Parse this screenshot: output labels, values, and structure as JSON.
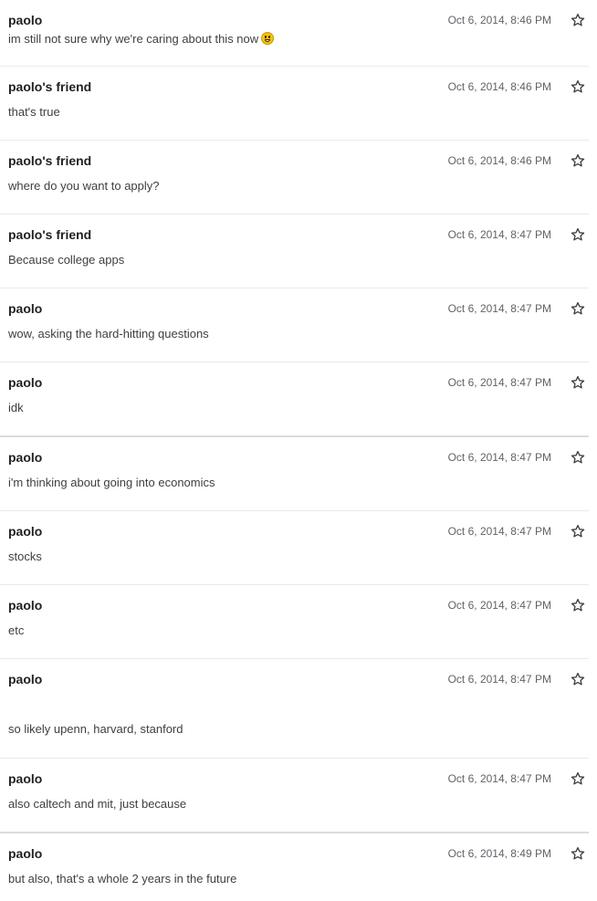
{
  "messages": [
    {
      "sender": "paolo",
      "time": "Oct 6, 2014, 8:46 PM",
      "text": "im still not sure why we're caring about this now",
      "emoji": "grinning-face-emoji"
    },
    {
      "sender": "paolo's friend",
      "time": "Oct 6, 2014, 8:46 PM",
      "text": "that's true"
    },
    {
      "sender": "paolo's friend",
      "time": "Oct 6, 2014, 8:46 PM",
      "text": "where do you want to apply?"
    },
    {
      "sender": "paolo's friend",
      "time": "Oct 6, 2014, 8:47 PM",
      "text": "Because college apps"
    },
    {
      "sender": "paolo",
      "time": "Oct 6, 2014, 8:47 PM",
      "text": "wow, asking the hard-hitting questions"
    },
    {
      "sender": "paolo",
      "time": "Oct 6, 2014, 8:47 PM",
      "text": "idk"
    },
    {
      "sender": "paolo",
      "time": "Oct 6, 2014, 8:47 PM",
      "text": "i'm thinking about going into economics"
    },
    {
      "sender": "paolo",
      "time": "Oct 6, 2014, 8:47 PM",
      "text": "stocks"
    },
    {
      "sender": "paolo",
      "time": "Oct 6, 2014, 8:47 PM",
      "text": "etc"
    },
    {
      "sender": "paolo",
      "time": "Oct 6, 2014, 8:47 PM",
      "text": "so likely upenn, harvard, stanford"
    },
    {
      "sender": "paolo",
      "time": "Oct 6, 2014, 8:47 PM",
      "text": "also caltech and mit, just because"
    },
    {
      "sender": "paolo",
      "time": "Oct 6, 2014, 8:49 PM",
      "text": "but also, that's a whole 2 years in the future"
    }
  ],
  "icons": {
    "star": "star-outline-icon"
  }
}
